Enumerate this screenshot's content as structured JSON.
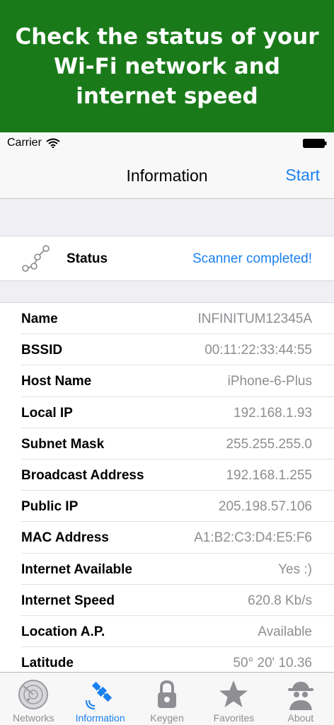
{
  "banner": {
    "text": "Check the status of your Wi-Fi network and internet speed"
  },
  "statusbar": {
    "carrier": "Carrier"
  },
  "navbar": {
    "title": "Information",
    "start_label": "Start"
  },
  "status": {
    "label": "Status",
    "value": "Scanner completed!"
  },
  "info": {
    "rows": [
      {
        "label": "Name",
        "value": "INFINITUM12345A"
      },
      {
        "label": "BSSID",
        "value": "00:11:22:33:44:55"
      },
      {
        "label": "Host Name",
        "value": "iPhone-6-Plus"
      },
      {
        "label": "Local IP",
        "value": "192.168.1.93"
      },
      {
        "label": "Subnet Mask",
        "value": "255.255.255.0"
      },
      {
        "label": "Broadcast Address",
        "value": "192.168.1.255"
      },
      {
        "label": "Public IP",
        "value": "205.198.57.106"
      },
      {
        "label": "MAC Address",
        "value": "A1:B2:C3:D4:E5:F6"
      },
      {
        "label": "Internet Available",
        "value": "Yes :)"
      },
      {
        "label": "Internet Speed",
        "value": "620.8 Kb/s"
      },
      {
        "label": "Location A.P.",
        "value": "Available"
      },
      {
        "label": "Latitude",
        "value": "50° 20' 10.36"
      }
    ]
  },
  "tabbar": {
    "tabs": [
      {
        "label": "Networks",
        "icon": "radar-icon"
      },
      {
        "label": "Information",
        "icon": "satellite-icon",
        "active": true
      },
      {
        "label": "Keygen",
        "icon": "padlock-icon"
      },
      {
        "label": "Favorites",
        "icon": "star-icon"
      },
      {
        "label": "About",
        "icon": "spy-icon"
      }
    ]
  },
  "colors": {
    "banner": "#1a7a1a",
    "accent": "#1a80f0",
    "value_gray": "#8e8e93"
  }
}
